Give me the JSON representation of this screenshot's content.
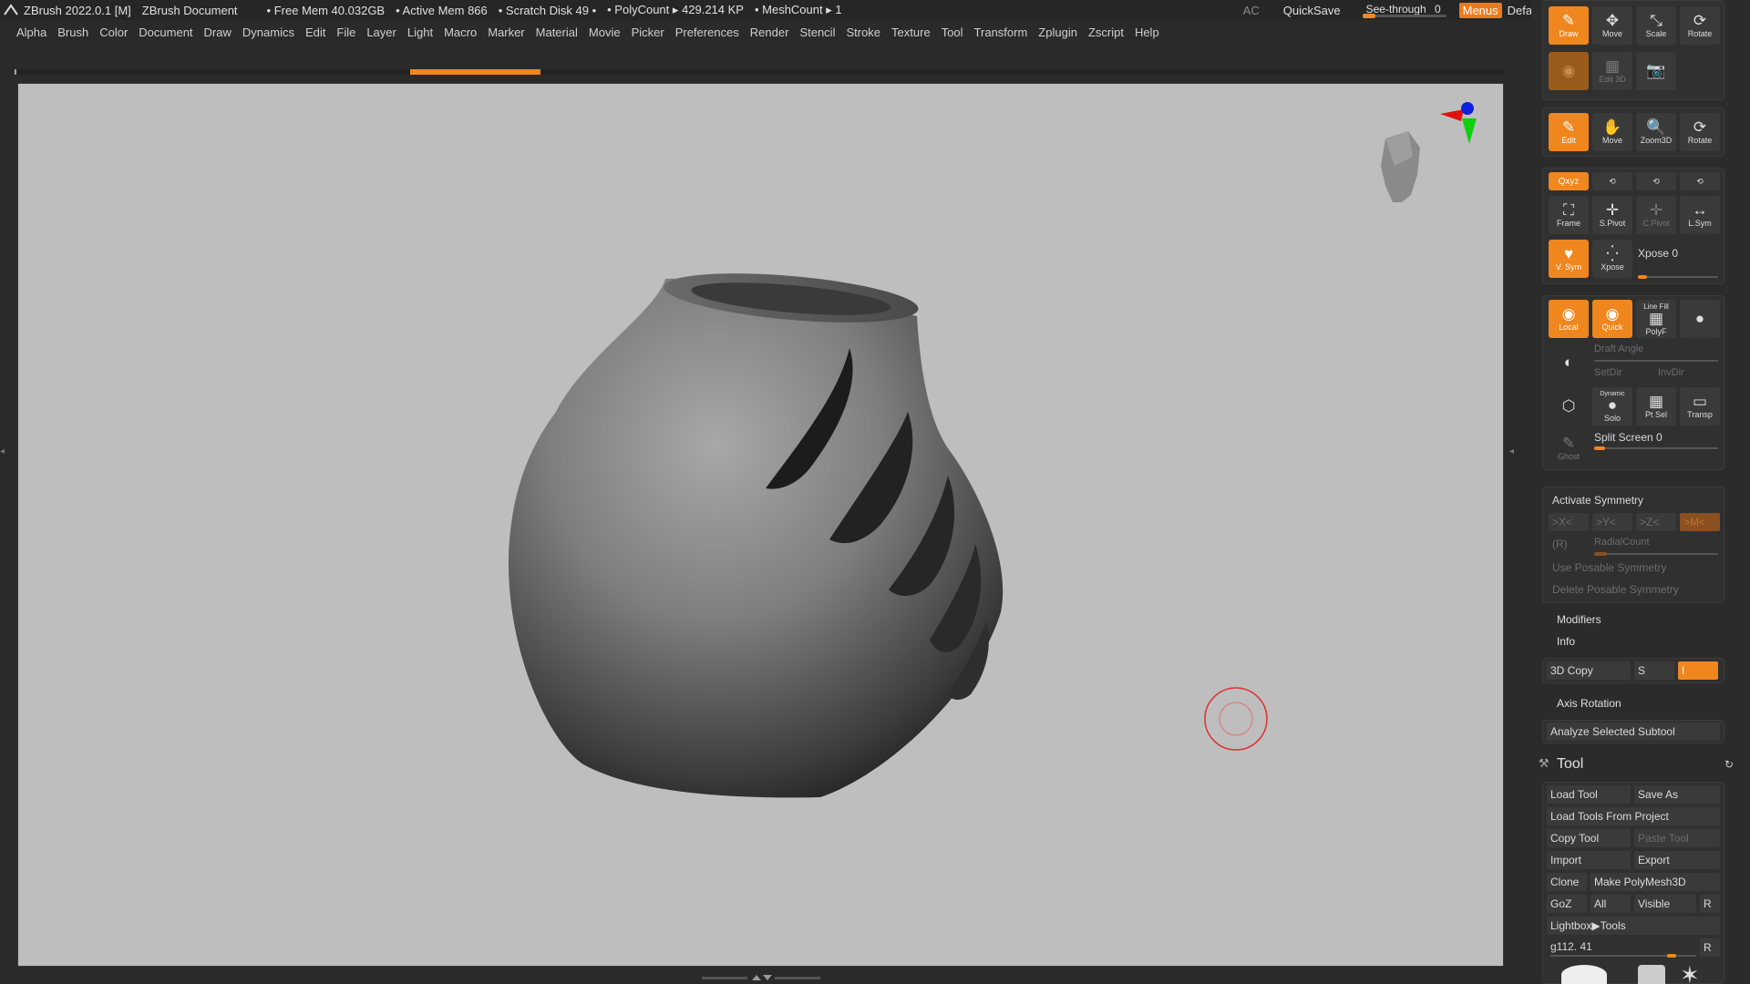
{
  "titlebar": {
    "app": "ZBrush 2022.0.1 [M]",
    "document": "ZBrush Document",
    "free_mem": "• Free Mem 40.032GB",
    "active_mem": "• Active Mem 866",
    "scratch": "• Scratch Disk 49 •",
    "polycount": "• PolyCount ▸ 429.214 KP",
    "meshcount": "• MeshCount ▸ 1",
    "ac": "AC",
    "quicksave": "QuickSave",
    "see_through_label": "See-through",
    "see_through_value": "0",
    "menus": "Menus",
    "script": "DefaultZScript",
    "win_btns": [
      "‹‹‹",
      "›››",
      "⧉",
      "⧉",
      "—",
      "❐",
      "✕"
    ]
  },
  "menubar": [
    "Alpha",
    "Brush",
    "Color",
    "Document",
    "Draw",
    "Dynamics",
    "Edit",
    "File",
    "Layer",
    "Light",
    "Macro",
    "Marker",
    "Material",
    "Movie",
    "Picker",
    "Preferences",
    "Render",
    "Stencil",
    "Stroke",
    "Texture",
    "Tool",
    "Transform",
    "Zplugin",
    "Zscript",
    "Help"
  ],
  "top_tools": {
    "draw": "Draw",
    "move": "Move",
    "scale": "Scale",
    "rotate": "Rotate",
    "edit_label": "Edit 3D"
  },
  "tool_row2": {
    "edit": "Edit",
    "move": "Move",
    "zoom3d": "Zoom3D",
    "rotate": "Rotate"
  },
  "nav": {
    "xyz": "Qxyz",
    "frame": "Frame",
    "spivot": "S.Pivot",
    "cpivot": "C.Pivot",
    "lsym": "L.Sym",
    "vsym": "V. Sym",
    "xpose": "Xpose",
    "xpose_slider": "Xpose 0"
  },
  "render_opts": {
    "local": "Local",
    "quick": "Quick",
    "line_fill": "Line Fill",
    "polyf": "PolyF",
    "draft_angle": "Draft Angle",
    "setdir": "SetDir",
    "invdir": "InvDir",
    "dynamic": "Dynamic",
    "solo": "Solo",
    "ptsel": "Pt Sel",
    "transp": "Transp",
    "ghost": "Ghost",
    "split_screen": "Split Screen 0"
  },
  "symmetry": {
    "activate": "Activate Symmetry",
    "x": ">X<",
    "y": ">Y<",
    "z": ">Z<",
    "m": ">M<",
    "r": "(R)",
    "radial": "RadialCount",
    "use_posable": "Use Posable Symmetry",
    "delete_posable": "Delete Posable Symmetry"
  },
  "sections": {
    "modifiers": "Modifiers",
    "info": "Info",
    "copy3d": "3D Copy",
    "s": "S",
    "axis_rotation": "Axis Rotation",
    "analyze": "Analyze Selected Subtool"
  },
  "tool": {
    "title": "Tool",
    "load_tool": "Load Tool",
    "save_as": "Save As",
    "load_from_project": "Load Tools From Project",
    "copy_tool": "Copy Tool",
    "paste_tool": "Paste Tool",
    "import": "Import",
    "export": "Export",
    "clone": "Clone",
    "make_polymesh": "Make PolyMesh3D",
    "goz": "GoZ",
    "all": "All",
    "visible": "Visible",
    "r": "R",
    "lightbox": "Lightbox▶Tools",
    "current": "g112. 41",
    "r2": "R"
  },
  "colors": {
    "accent": "#f0861e",
    "canvas": "#bebebe",
    "panel": "#2b2b2b"
  }
}
